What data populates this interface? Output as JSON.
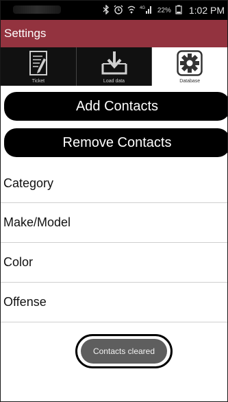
{
  "status_bar": {
    "icons": [
      "bluetooth-icon",
      "alarm-icon",
      "wifi-icon",
      "4g-signal-icon",
      "battery-icon"
    ],
    "network_label": "4G",
    "battery": "22%",
    "time": "1:02 PM"
  },
  "header": {
    "title": "Settings"
  },
  "tabs": [
    {
      "label": "Ticket",
      "icon": "ticket-edit-icon",
      "active": false
    },
    {
      "label": "Load data",
      "icon": "download-tray-icon",
      "active": false
    },
    {
      "label": "Database",
      "icon": "gear-icon",
      "active": true
    }
  ],
  "buttons": {
    "add_contacts": "Add Contacts",
    "remove_contacts": "Remove Contacts"
  },
  "list": {
    "items": [
      {
        "label": "Category"
      },
      {
        "label": "Make/Model"
      },
      {
        "label": "Color"
      },
      {
        "label": "Offense"
      }
    ]
  },
  "toast": {
    "message": "Contacts cleared"
  },
  "colors": {
    "title_bar": "#93333f",
    "status_bar": "#000000",
    "buttons": "#000000",
    "toast_bg": "#5e5e5e"
  }
}
